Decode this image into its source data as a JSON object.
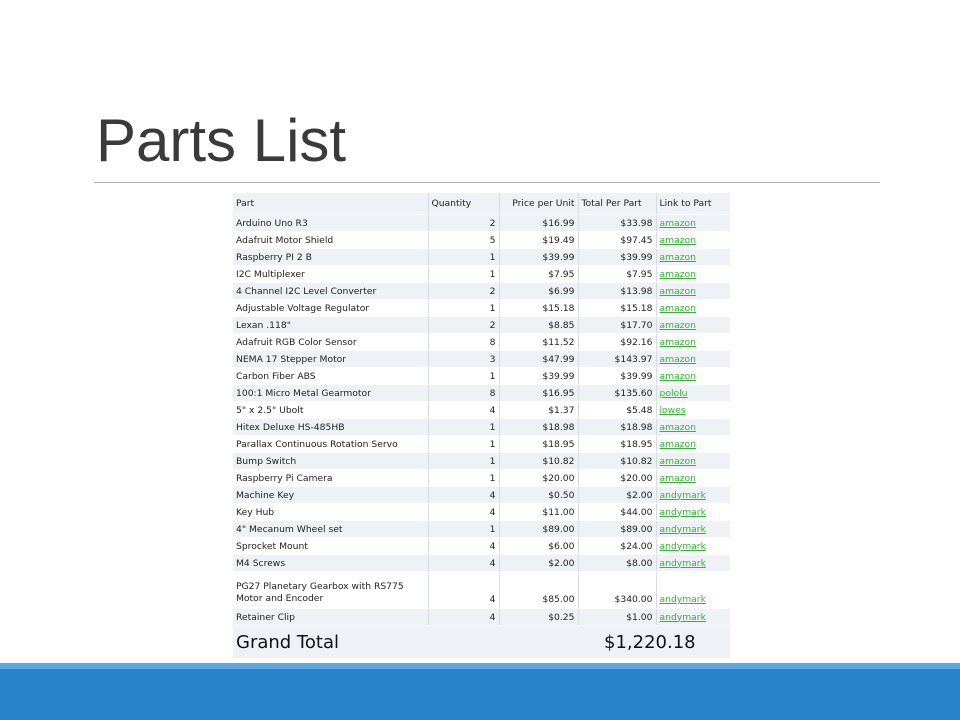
{
  "slide": {
    "title": "Parts List"
  },
  "table": {
    "headers": {
      "part": "Part",
      "quantity": "Quantity",
      "price": "Price per Unit",
      "total": "Total Per Part",
      "link": "Link to Part"
    },
    "rows": [
      {
        "part": "Arduino Uno R3",
        "qty": "2",
        "price": "$16.99",
        "total": "$33.98",
        "link": "amazon"
      },
      {
        "part": "Adafruit Motor Shield",
        "qty": "5",
        "price": "$19.49",
        "total": "$97.45",
        "link": "amazon"
      },
      {
        "part": "Raspberry PI 2 B",
        "qty": "1",
        "price": "$39.99",
        "total": "$39.99",
        "link": "amazon"
      },
      {
        "part": "I2C Multiplexer",
        "qty": "1",
        "price": "$7.95",
        "total": "$7.95",
        "link": "amazon"
      },
      {
        "part": "4 Channel I2C Level Converter",
        "qty": "2",
        "price": "$6.99",
        "total": "$13.98",
        "link": "amazon"
      },
      {
        "part": "Adjustable Voltage Regulator",
        "qty": "1",
        "price": "$15.18",
        "total": "$15.18",
        "link": "amazon"
      },
      {
        "part": "Lexan .118\"",
        "qty": "2",
        "price": "$8.85",
        "total": "$17.70",
        "link": "amazon"
      },
      {
        "part": "Adafruit RGB Color Sensor",
        "qty": "8",
        "price": "$11.52",
        "total": "$92.16",
        "link": "amazon"
      },
      {
        "part": "NEMA 17 Stepper Motor",
        "qty": "3",
        "price": "$47.99",
        "total": "$143.97",
        "link": "amazon"
      },
      {
        "part": "Carbon Fiber ABS",
        "qty": "1",
        "price": "$39.99",
        "total": "$39.99",
        "link": "amazon"
      },
      {
        "part": "100:1 Micro Metal Gearmotor",
        "qty": "8",
        "price": "$16.95",
        "total": "$135.60",
        "link": "pololu"
      },
      {
        "part": "5\" x 2.5\" Ubolt",
        "qty": "4",
        "price": "$1.37",
        "total": "$5.48",
        "link": "lowes"
      },
      {
        "part": "Hitex Deluxe HS-485HB",
        "qty": "1",
        "price": "$18.98",
        "total": "$18.98",
        "link": "amazon"
      },
      {
        "part": "Parallax Continuous Rotation Servo",
        "qty": "1",
        "price": "$18.95",
        "total": "$18.95",
        "link": "amazon"
      },
      {
        "part": "Bump Switch",
        "qty": "1",
        "price": "$10.82",
        "total": "$10.82",
        "link": "amazon"
      },
      {
        "part": "Raspberry Pi Camera",
        "qty": "1",
        "price": "$20.00",
        "total": "$20.00",
        "link": "amazon"
      },
      {
        "part": "Machine Key",
        "qty": "4",
        "price": "$0.50",
        "total": "$2.00",
        "link": "andymark"
      },
      {
        "part": "Key Hub",
        "qty": "4",
        "price": "$11.00",
        "total": "$44.00",
        "link": "andymark"
      },
      {
        "part": "4\" Mecanum Wheel set",
        "qty": "1",
        "price": "$89.00",
        "total": "$89.00",
        "link": "andymark"
      },
      {
        "part": "Sprocket Mount",
        "qty": "4",
        "price": "$6.00",
        "total": "$24.00",
        "link": "andymark"
      },
      {
        "part": "M4 Screws",
        "qty": "4",
        "price": "$2.00",
        "total": "$8.00",
        "link": "andymark"
      },
      {
        "part": "PG27 Planetary Gearbox with RS775 Motor and Encoder",
        "qty": "4",
        "price": "$85.00",
        "total": "$340.00",
        "link": "andymark"
      },
      {
        "part": "Retainer Clip",
        "qty": "4",
        "price": "$0.25",
        "total": "$1.00",
        "link": "andymark"
      }
    ],
    "grand_total": {
      "label": "Grand Total",
      "value": "$1,220.18"
    }
  }
}
